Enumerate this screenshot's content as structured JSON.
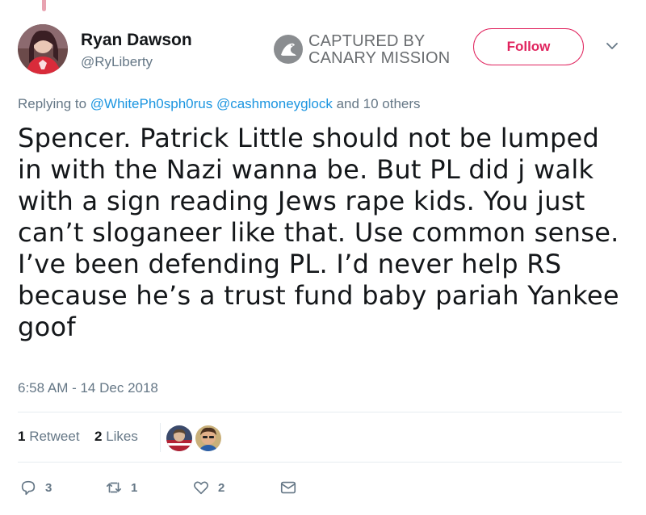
{
  "user": {
    "name": "Ryan Dawson",
    "handle": "@RyLiberty"
  },
  "watermark": {
    "line1": "CAPTURED BY",
    "line2": "CANARY MISSION"
  },
  "follow_label": "Follow",
  "reply_context": {
    "prefix": "Replying to ",
    "mention1": "@WhitePh0sph0rus",
    "mention2": "@cashmoneyglock",
    "suffix": " and 10 others"
  },
  "tweet_lines": [
    "Spencer. Patrick Little should not be lumped",
    "in with the Nazi wanna be. But PL did j walk",
    "with a sign reading Jews rape kids. You just",
    "can’t sloganeer like that. Use common sense.",
    "I’ve been defending PL. I’d never help RS",
    "because he’s a trust fund baby pariah Yankee",
    "goof"
  ],
  "timestamp": "6:58 AM - 14 Dec 2018",
  "stats": {
    "retweets_count": "1",
    "retweets_label": " Retweet",
    "likes_count": "2",
    "likes_label": " Likes"
  },
  "actions": {
    "reply_count": "3",
    "retweet_count": "1",
    "like_count": "2"
  },
  "colors": {
    "follow_accent": "#e0245e",
    "link": "#1b95e0",
    "secondary_text": "#657786"
  },
  "icons": [
    "canary-mission-logo",
    "chevron-down-icon",
    "reply-icon",
    "retweet-icon",
    "heart-icon",
    "envelope-icon"
  ]
}
